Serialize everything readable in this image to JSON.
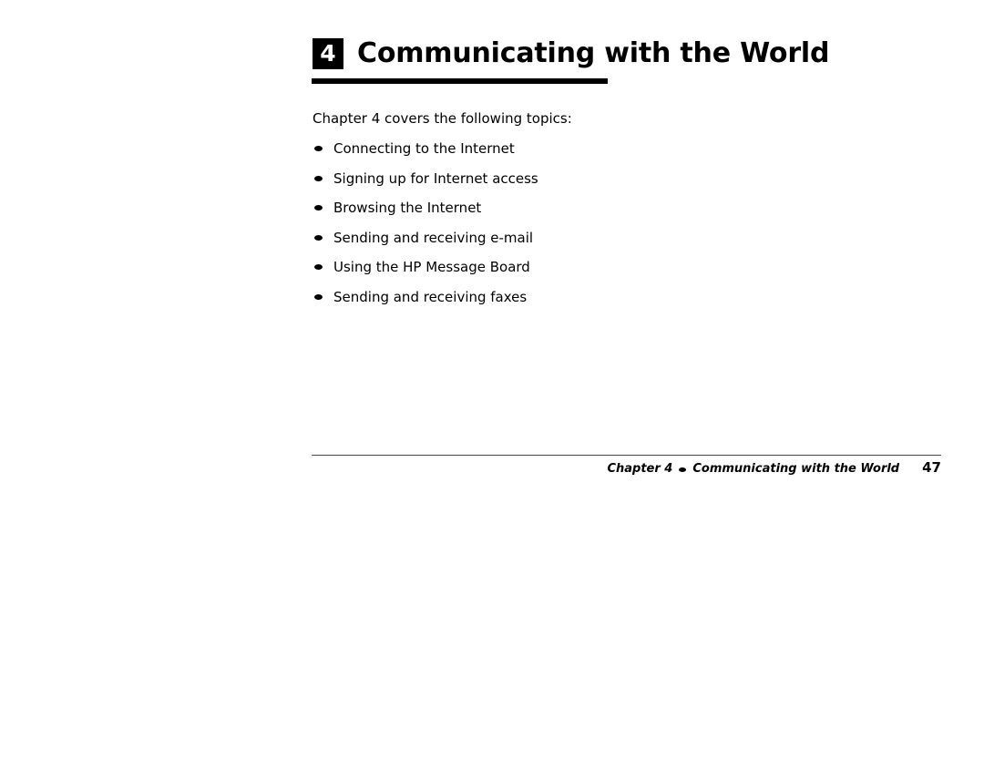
{
  "page": {
    "background_color": "#ffffff",
    "text_color": "#000000"
  },
  "heading": {
    "chapter_number": "4",
    "title": "Communicating with the World",
    "badge_background": "#000000",
    "badge_text_color": "#ffffff",
    "rule_color": "#000000"
  },
  "body": {
    "intro": "Chapter 4 covers the following topics:",
    "topics": [
      {
        "label": "Connecting to the Internet"
      },
      {
        "label": "Signing up for Internet access"
      },
      {
        "label": "Browsing the Internet"
      },
      {
        "label": "Sending and receiving e-mail"
      },
      {
        "label": "Using the HP Message Board"
      },
      {
        "label": "Sending and receiving faxes"
      }
    ]
  },
  "footer": {
    "chapter_label": "Chapter 4",
    "separator_icon": "bullet-icon",
    "title": "Communicating with the World",
    "page_number": "47",
    "rule_color": "#4a4a4a"
  }
}
